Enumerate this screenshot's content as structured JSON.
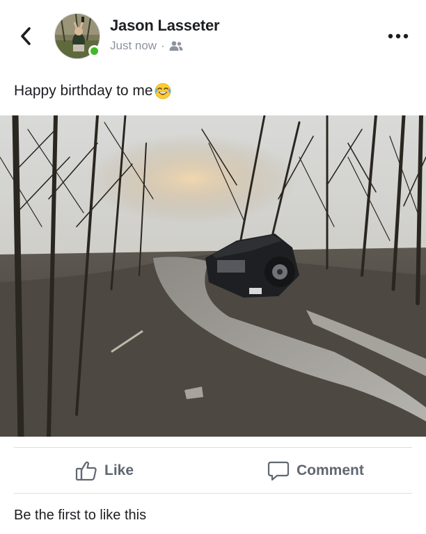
{
  "header": {
    "back_icon": "chevron-left-icon",
    "author_name": "Jason Lasseter",
    "timestamp": "Just now",
    "separator": "·",
    "audience_icon": "friends-icon",
    "more_icon": "more-horizontal-icon",
    "online_color": "#42b72a"
  },
  "post": {
    "text": "Happy birthday to me",
    "emoji_icon": "tears-of-joy-emoji-icon",
    "photo_description_icon": "photo-jeep-stuck-in-mud"
  },
  "actions": {
    "like_label": "Like",
    "comment_label": "Comment",
    "icon_color": "#606770"
  },
  "footer": {
    "likes_text": "Be the first to like this"
  }
}
